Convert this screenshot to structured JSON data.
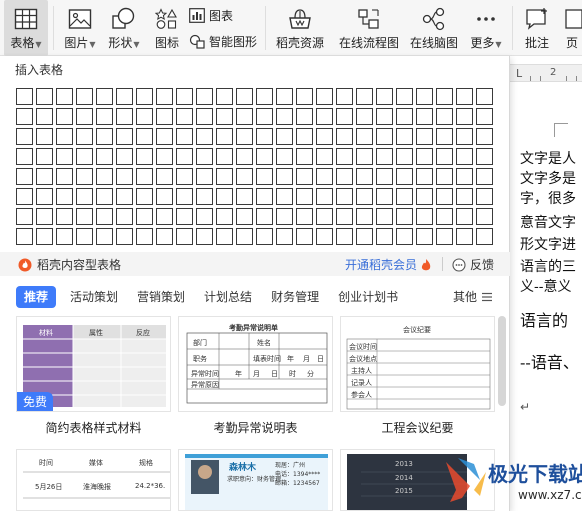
{
  "ribbon": {
    "table": {
      "label": "表格",
      "icon": "table-icon"
    },
    "picture": {
      "label": "图片",
      "icon": "picture-icon"
    },
    "shape": {
      "label": "形状",
      "icon": "shape-icon"
    },
    "icons": {
      "label": "图标",
      "icon": "icons-icon"
    },
    "chart": {
      "label": "图表",
      "icon": "chart-icon"
    },
    "smart": {
      "label": "智能图形",
      "icon": "smart-shape-icon"
    },
    "daoke": {
      "label": "稻壳资源",
      "icon": "daoke-icon"
    },
    "flow": {
      "label": "在线流程图",
      "icon": "flowchart-icon"
    },
    "mind": {
      "label": "在线脑图",
      "icon": "mindmap-icon"
    },
    "more": {
      "label": "更多",
      "icon": "more-icon"
    },
    "comment": {
      "label": "批注",
      "icon": "comment-icon"
    },
    "page": {
      "label": "页"
    }
  },
  "panel": {
    "title": "插入表格",
    "grid": {
      "cols": 24,
      "rows": 8
    },
    "promo": {
      "label": "稻壳内容型表格",
      "vip": "开通稻壳会员",
      "feedback": "反馈"
    },
    "tabs": [
      "推荐",
      "活动策划",
      "营销策划",
      "计划总结",
      "财务管理",
      "创业计划书"
    ],
    "more": "其他",
    "templates": [
      {
        "label": "简约表格样式材料",
        "badge": "免费",
        "header": [
          "材料",
          "属性",
          "反应"
        ]
      },
      {
        "label": "考勤异常说明表",
        "title": "考勤异常说明单",
        "rows": [
          "部门",
          "职务",
          "异常时间",
          "异常原因"
        ],
        "row_extras": [
          "姓名",
          "填表时间",
          "年",
          "月",
          "日"
        ],
        "date_parts": [
          "年",
          "月",
          "日",
          "时",
          "分"
        ]
      },
      {
        "label": "工程会议纪要",
        "title": "会议纪要",
        "rows": [
          "会议时间",
          "会议地点",
          "主持人",
          "记录人",
          "参会人"
        ]
      }
    ],
    "templates_row2": [
      {
        "headers": [
          "时间",
          "媒体",
          "规格"
        ],
        "row": [
          "5月26日",
          "淮海晚报",
          "24.2*36."
        ]
      },
      {
        "name": "森林木",
        "info": [
          "现居：广州",
          "电话：1394****",
          "邮箱：1234567"
        ],
        "role": "求职意向：财务管理"
      },
      {
        "years": [
          "2013",
          "2014",
          "2015"
        ]
      }
    ]
  },
  "document": {
    "ruler_number": "2",
    "lines": [
      "文字是人",
      "文字多是",
      "字，很多",
      "意音文字",
      "形文字进",
      "语言的三",
      "义--意义"
    ],
    "line_big": "语言的",
    "line_big2": "--语音、"
  },
  "watermark": {
    "text": "极光下载站",
    "url": "www.xz7.com"
  }
}
